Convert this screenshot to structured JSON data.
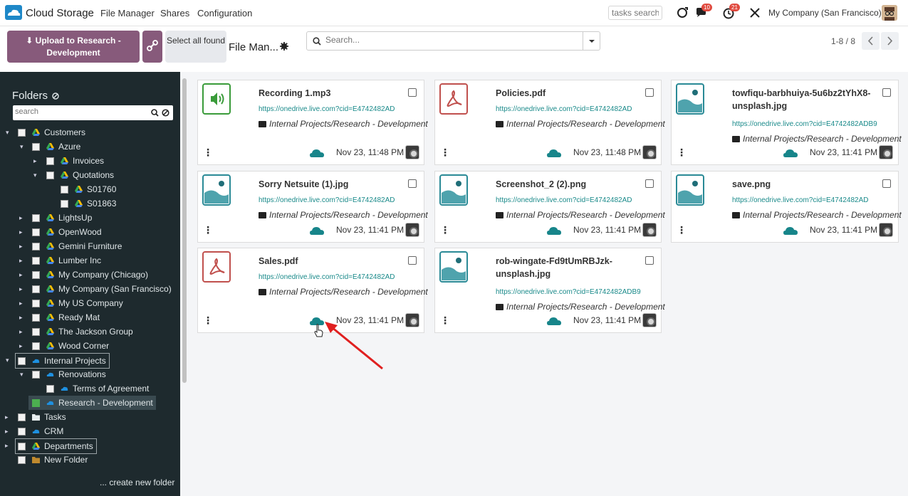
{
  "topnav": {
    "app_title": "Cloud Storage",
    "menu": [
      "File Manager",
      "Shares",
      "Configuration"
    ],
    "tasks_search_placeholder": "tasks search",
    "messages_badge": "10",
    "activities_badge": "21",
    "company": "My Company (San Francisco)"
  },
  "controls": {
    "upload_label": "Upload to Research - Development",
    "select_all_label": "Select all found",
    "view_title": "File Man...",
    "search_placeholder": "Search...",
    "pager": "1-8 / 8"
  },
  "sidebar": {
    "heading": "Folders",
    "search_placeholder": "search",
    "create_label": "... create new folder",
    "items": [
      {
        "label": "Customers"
      },
      {
        "label": "Azure"
      },
      {
        "label": "Invoices"
      },
      {
        "label": "Quotations"
      },
      {
        "label": "S01760"
      },
      {
        "label": "S01863"
      },
      {
        "label": "LightsUp"
      },
      {
        "label": "OpenWood"
      },
      {
        "label": "Gemini Furniture"
      },
      {
        "label": "Lumber Inc"
      },
      {
        "label": "My Company (Chicago)"
      },
      {
        "label": "My Company (San Francisco)"
      },
      {
        "label": "My US Company"
      },
      {
        "label": "Ready Mat"
      },
      {
        "label": "The Jackson Group"
      },
      {
        "label": "Wood Corner"
      },
      {
        "label": "Internal Projects"
      },
      {
        "label": "Renovations"
      },
      {
        "label": "Terms of Agreement"
      },
      {
        "label": "Research - Development"
      },
      {
        "label": "Tasks"
      },
      {
        "label": "CRM"
      },
      {
        "label": "Departments"
      },
      {
        "label": "New Folder"
      }
    ]
  },
  "cards": [
    {
      "name": "Recording 1.mp3",
      "url": "https://onedrive.live.com?cid=E4742482AD",
      "path": "Internal Projects/Research - Development",
      "date": "Nov 23, 11:48 PM",
      "type": "audio"
    },
    {
      "name": "Policies.pdf",
      "url": "https://onedrive.live.com?cid=E4742482AD",
      "path": "Internal Projects/Research - Development",
      "date": "Nov 23, 11:48 PM",
      "type": "pdf"
    },
    {
      "name": "towfiqu-barbhuiya-5u6bz2tYhX8-unsplash.jpg",
      "url": "https://onedrive.live.com?cid=E4742482ADB9A",
      "path": "Internal Projects/Research - Development",
      "date": "Nov 23, 11:41 PM",
      "type": "image"
    },
    {
      "name": "Sorry Netsuite (1).jpg",
      "url": "https://onedrive.live.com?cid=E4742482AD",
      "path": "Internal Projects/Research - Development",
      "date": "Nov 23, 11:41 PM",
      "type": "image"
    },
    {
      "name": "Screenshot_2 (2).png",
      "url": "https://onedrive.live.com?cid=E4742482AD",
      "path": "Internal Projects/Research - Development",
      "date": "Nov 23, 11:41 PM",
      "type": "image"
    },
    {
      "name": "save.png",
      "url": "https://onedrive.live.com?cid=E4742482AD",
      "path": "Internal Projects/Research - Development",
      "date": "Nov 23, 11:41 PM",
      "type": "image"
    },
    {
      "name": "Sales.pdf",
      "url": "https://onedrive.live.com?cid=E4742482AD",
      "path": "Internal Projects/Research - Development",
      "date": "Nov 23, 11:41 PM",
      "type": "pdf"
    },
    {
      "name": "rob-wingate-Fd9tUmRBJzk-unsplash.jpg",
      "url": "https://onedrive.live.com?cid=E4742482ADB9A",
      "path": "Internal Projects/Research - Development",
      "date": "Nov 23, 11:41 PM",
      "type": "image"
    }
  ],
  "colors": {
    "accent": "#875a7b",
    "sidebar_bg": "#1e2a2e",
    "link": "#1a8a8a",
    "cloud": "#17858a",
    "annotation_arrow": "#e02020"
  }
}
